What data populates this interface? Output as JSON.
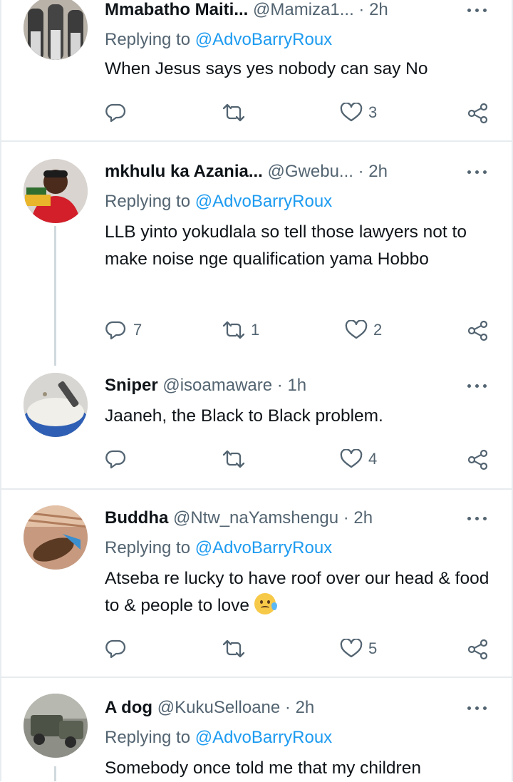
{
  "reply_prefix": "Replying to",
  "tweets": [
    {
      "name": "Mmabatho Maiti...",
      "handle_time": "@Mamiza1... · 2h",
      "replying_to": "@AdvoBarryRoux",
      "text": "When Jesus says yes nobody can say No",
      "counts": {
        "reply": "",
        "retweet": "",
        "like": "3"
      }
    },
    {
      "name": "mkhulu ka Azania...",
      "handle_time": "@Gwebu... · 2h",
      "replying_to": "@AdvoBarryRoux",
      "text": "LLB yinto yokudlala so tell those lawyers not to make noise nge qualification yama Hobbo",
      "counts": {
        "reply": "7",
        "retweet": "1",
        "like": "2"
      }
    },
    {
      "name": "Sniper",
      "handle_time": "@isoamaware · 1h",
      "replying_to": "",
      "text": "Jaaneh, the Black to Black problem.",
      "counts": {
        "reply": "",
        "retweet": "",
        "like": "4"
      }
    },
    {
      "name": "Buddha",
      "handle_time": "@Ntw_naYamshengu · 2h",
      "replying_to": "@AdvoBarryRoux",
      "text": "Atseba re lucky to have roof over our head & food to & people to love",
      "counts": {
        "reply": "",
        "retweet": "",
        "like": "5"
      }
    },
    {
      "name": "A dog",
      "handle_time": "@KukuSelloane · 2h",
      "replying_to": "@AdvoBarryRoux",
      "text": "Somebody once told me that my children",
      "counts": {
        "reply": "",
        "retweet": "",
        "like": ""
      }
    }
  ],
  "icons": {
    "reply": "reply-icon",
    "retweet": "retweet-icon",
    "like": "heart-icon",
    "share": "share-icon",
    "more": "more-icon"
  },
  "colors": {
    "text": "#0f1419",
    "secondary": "#536471",
    "link": "#1d9bf0",
    "divider": "#e7ecef"
  }
}
